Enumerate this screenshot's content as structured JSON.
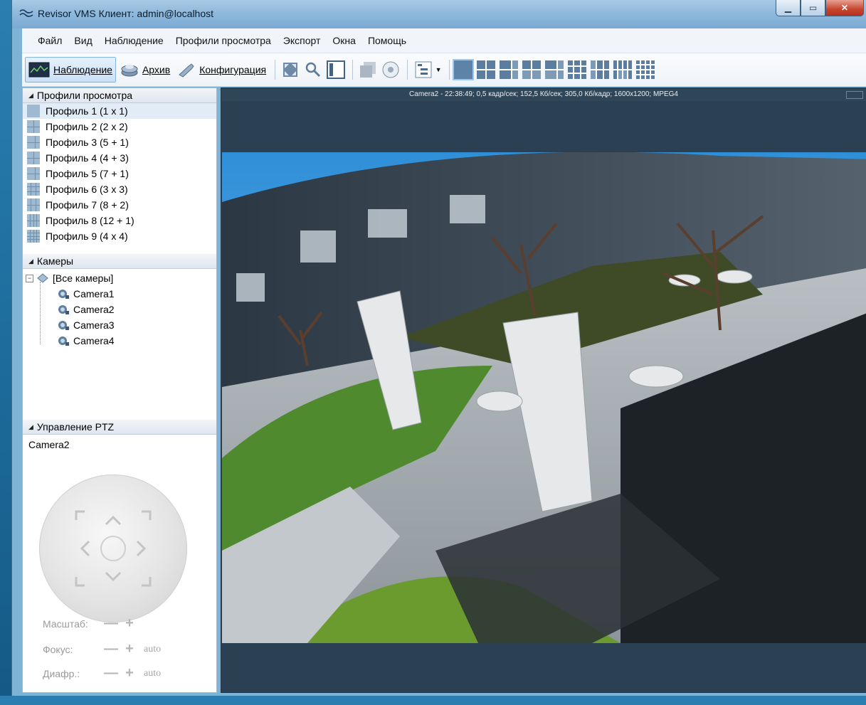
{
  "window": {
    "title": "Revisor VMS Клиент: admin@localhost"
  },
  "menu": [
    {
      "label": "Файл"
    },
    {
      "label": "Вид"
    },
    {
      "label": "Наблюдение"
    },
    {
      "label": "Профили просмотра"
    },
    {
      "label": "Экспорт"
    },
    {
      "label": "Окна"
    },
    {
      "label": "Помощь"
    }
  ],
  "toolbar": {
    "surveillance_label": "Наблюдение",
    "archive_label": "Архив",
    "config_label": "Конфигурация"
  },
  "profiles": {
    "header": "Профили просмотра",
    "items": [
      {
        "label": "Профиль 1 (1 x 1)"
      },
      {
        "label": "Профиль 2 (2 x 2)"
      },
      {
        "label": "Профиль 3 (5 + 1)"
      },
      {
        "label": "Профиль 4 (4 + 3)"
      },
      {
        "label": "Профиль 5 (7 + 1)"
      },
      {
        "label": "Профиль 6 (3 x 3)"
      },
      {
        "label": "Профиль 7 (8 + 2)"
      },
      {
        "label": "Профиль 8 (12 + 1)"
      },
      {
        "label": "Профиль 9 (4 x 4)"
      }
    ]
  },
  "cameras": {
    "header": "Камеры",
    "root": "[Все камеры]",
    "items": [
      {
        "label": "Camera1"
      },
      {
        "label": "Camera2"
      },
      {
        "label": "Camera3"
      },
      {
        "label": "Camera4"
      }
    ]
  },
  "ptz": {
    "header": "Управление PTZ",
    "camera": "Camera2",
    "zoom_label": "Масштаб:",
    "focus_label": "Фокус:",
    "iris_label": "Диафр.:",
    "auto": "auto"
  },
  "video": {
    "info": "Camera2 - 22:38:49; 0,5 кадр/сек; 152,5 Кб/сек; 305,0 Кб/кадр; 1600x1200; MPEG4"
  }
}
